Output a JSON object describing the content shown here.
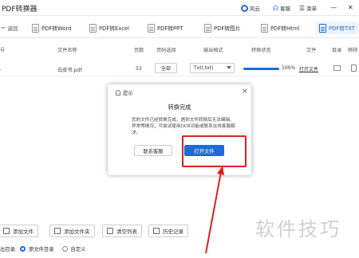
{
  "app": {
    "title": "PDF转换器"
  },
  "titlebar": {
    "user": "风云",
    "service": "客服",
    "menu": "菜单"
  },
  "tabs": {
    "back": "返回",
    "items": [
      "PDF转Word",
      "PDF转Excel",
      "PDF转PPT",
      "PDF转图片",
      "PDF转Html",
      "PDF转TXT"
    ]
  },
  "table": {
    "headers": [
      "号",
      "文件名称",
      "页数",
      "页码选择",
      "输出格式",
      "转换状态",
      "文件",
      "目录",
      "移除"
    ],
    "row": {
      "name": "白皮书.pdf",
      "pages": "53",
      "page_select": "全部",
      "format": "Txt(.txt)",
      "progress": 1.0,
      "percent": "100%",
      "open": "打开文件"
    }
  },
  "bottom": {
    "buttons": [
      "添加文件",
      "添加文件夹",
      "清空列表",
      "历史记录"
    ]
  },
  "output": {
    "label": "出目录:",
    "opt1": "原文件目录",
    "opt2": "自定义"
  },
  "dialog": {
    "title": "提示",
    "close": "×",
    "heading": "转换完成",
    "message": "您的文件已经转换完成，遇到文件转换后无法编辑、异常等情况，可尝试使用OCR功能或联系在线客服解决。",
    "btn_contact": "联系客服",
    "btn_open": "打开文件"
  },
  "watermark": "软件技巧",
  "colors": {
    "accent": "#1f6ad6",
    "highlight": "#e02020"
  }
}
